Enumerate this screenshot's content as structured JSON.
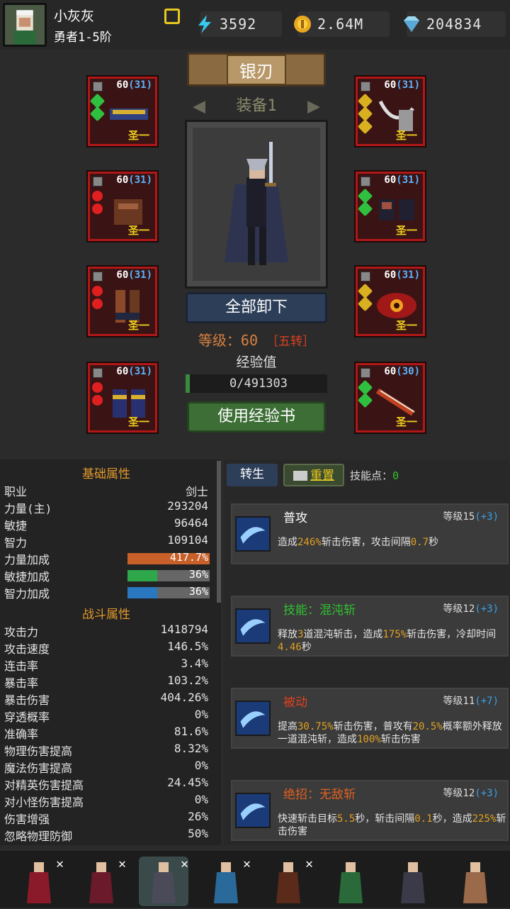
{
  "player": {
    "name": "小灰灰",
    "rank": "勇者1-5阶"
  },
  "resources": [
    {
      "icon": "energy-icon",
      "value": "3592"
    },
    {
      "icon": "gold-coin-icon",
      "value": "2.64M"
    },
    {
      "icon": "diamond-icon",
      "value": "204834"
    }
  ],
  "hero": {
    "name": "银刃",
    "set_label": "装备1",
    "unequip_label": "全部卸下",
    "level_label": "等级：60",
    "rebirth": "［五转］",
    "exp_label": "经验值",
    "exp_value": "0/491303",
    "exp_fraction": 0,
    "use_exp_label": "使用经验书"
  },
  "equipment": [
    {
      "level": "60",
      "bonus": "(31)",
      "tier": "圣一",
      "gems": [
        "green",
        "green"
      ]
    },
    {
      "level": "60",
      "bonus": "(31)",
      "tier": "圣一",
      "gems": [
        "yellow",
        "yellow",
        "yellow"
      ]
    },
    {
      "level": "60",
      "bonus": "(31)",
      "tier": "圣一",
      "gems": [
        "red",
        "red"
      ]
    },
    {
      "level": "60",
      "bonus": "(31)",
      "tier": "圣一",
      "gems": [
        "green",
        "green"
      ]
    },
    {
      "level": "60",
      "bonus": "(31)",
      "tier": "圣一",
      "gems": [
        "red",
        "red"
      ]
    },
    {
      "level": "60",
      "bonus": "(31)",
      "tier": "圣一",
      "gems": [
        "yellow",
        "yellow"
      ]
    },
    {
      "level": "60",
      "bonus": "(31)",
      "tier": "圣一",
      "gems": [
        "red",
        "red"
      ]
    },
    {
      "level": "60",
      "bonus": "(30)",
      "tier": "圣一",
      "gems": [
        "green",
        "green"
      ]
    }
  ],
  "basic": {
    "title": "基础属性",
    "rows": [
      {
        "k": "职业",
        "v": "剑士"
      },
      {
        "k": "力量(主)",
        "v": "293204"
      },
      {
        "k": "敏捷",
        "v": "96464"
      },
      {
        "k": "智力",
        "v": "109104"
      }
    ],
    "bars": [
      {
        "k": "力量加成",
        "v": "417.7%",
        "fill": 1.0,
        "color": "#c8602a"
      },
      {
        "k": "敏捷加成",
        "v": "36%",
        "fill": 0.36,
        "color": "#2ea84a"
      },
      {
        "k": "智力加成",
        "v": "36%",
        "fill": 0.36,
        "color": "#2a78c0"
      }
    ]
  },
  "combat": {
    "title": "战斗属性",
    "rows": [
      {
        "k": "攻击力",
        "v": "1418794"
      },
      {
        "k": "攻击速度",
        "v": "146.5%"
      },
      {
        "k": "连击率",
        "v": "3.4%"
      },
      {
        "k": "暴击率",
        "v": "103.2%"
      },
      {
        "k": "暴击伤害",
        "v": "404.26%"
      },
      {
        "k": "穿透概率",
        "v": "0%"
      },
      {
        "k": "准确率",
        "v": "81.6%"
      },
      {
        "k": "物理伤害提高",
        "v": "8.32%"
      },
      {
        "k": "魔法伤害提高",
        "v": "0%"
      },
      {
        "k": "对精英伤害提高",
        "v": "24.45%"
      },
      {
        "k": "对小怪伤害提高",
        "v": "0%"
      },
      {
        "k": "伤害增强",
        "v": "26%"
      },
      {
        "k": "忽略物理防御",
        "v": "50%"
      }
    ]
  },
  "skills_panel": {
    "rebirth_tab": "转生",
    "reset_tab": "重置",
    "points_label": "技能点：",
    "points": "0"
  },
  "skills": [
    {
      "name": "普攻",
      "name_color": "#ffffff",
      "level": "等级15",
      "plus": "(+3)",
      "desc": [
        [
          "造成",
          ""
        ],
        [
          "246%",
          "h"
        ],
        [
          "斩击伤害，攻击间隔",
          ""
        ],
        [
          "0.7",
          "h"
        ],
        [
          "秒",
          ""
        ]
      ]
    },
    {
      "name": "技能：混沌斩",
      "name_color": "#30c030",
      "level": "等级12",
      "plus": "(+3)",
      "desc": [
        [
          "释放",
          ""
        ],
        [
          "3",
          "h"
        ],
        [
          "道混沌斩击，造成",
          ""
        ],
        [
          "175%",
          "h"
        ],
        [
          "斩击伤害，冷却时间",
          ""
        ],
        [
          "4.46",
          "h"
        ],
        [
          "秒",
          ""
        ]
      ]
    },
    {
      "name": "被动",
      "name_color": "#e04020",
      "level": "等级11",
      "plus": "(+7)",
      "desc": [
        [
          "提高",
          ""
        ],
        [
          "30.75%",
          "h"
        ],
        [
          "斩击伤害，普攻有",
          ""
        ],
        [
          "20.5%",
          "h"
        ],
        [
          "概率额外释放一道混沌斩，造成",
          ""
        ],
        [
          "100%",
          "h"
        ],
        [
          "斩击伤害",
          ""
        ]
      ]
    },
    {
      "name": "绝招：无敌斩",
      "name_color": "#e06020",
      "level": "等级12",
      "plus": "(+3)",
      "desc": [
        [
          "快速斩击目标",
          ""
        ],
        [
          "5.5",
          "h"
        ],
        [
          "秒，斩击间隔",
          ""
        ],
        [
          "0.1",
          "h"
        ],
        [
          "秒，造成",
          ""
        ],
        [
          "225%",
          "h"
        ],
        [
          "斩击伤害",
          ""
        ]
      ]
    }
  ],
  "roster": [
    "hero-mage-red",
    "hero-vampire",
    "hero-swordsman",
    "hero-ice-mage",
    "hero-demon-knight",
    "hero-archer",
    "hero-warrior",
    "hero-dancer"
  ]
}
